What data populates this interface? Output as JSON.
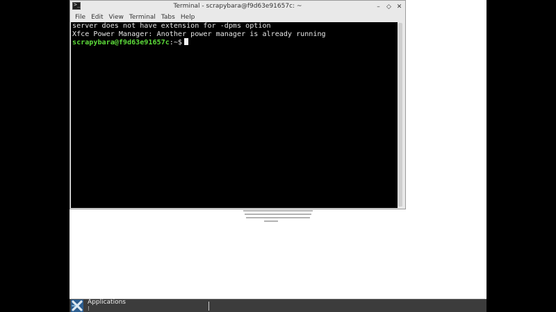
{
  "window": {
    "title": "Terminal - scrapybara@f9d63e91657c: ~",
    "controls": [
      "–",
      "◇",
      "✕"
    ]
  },
  "menu": [
    "File",
    "Edit",
    "View",
    "Terminal",
    "Tabs",
    "Help"
  ],
  "terminal": {
    "lines": [
      "server does not have extension for -dpms option",
      "Xfce Power Manager: Another power manager is already running"
    ],
    "prompt_user_host": "scrapybara@f9d63e91657c",
    "prompt_suffix": ":~$"
  },
  "taskbar": {
    "applications_label": "Applications",
    "applications_suffix": "⁝"
  },
  "colors": {
    "prompt_green": "#5ddc3a",
    "terminal_bg": "#000000",
    "taskbar_bg": "#3c3c3c",
    "desktop_bg": "#ffffff"
  },
  "icons": {
    "window_icon": "terminal-icon",
    "app_menu_icon": "xfce-logo-icon"
  }
}
